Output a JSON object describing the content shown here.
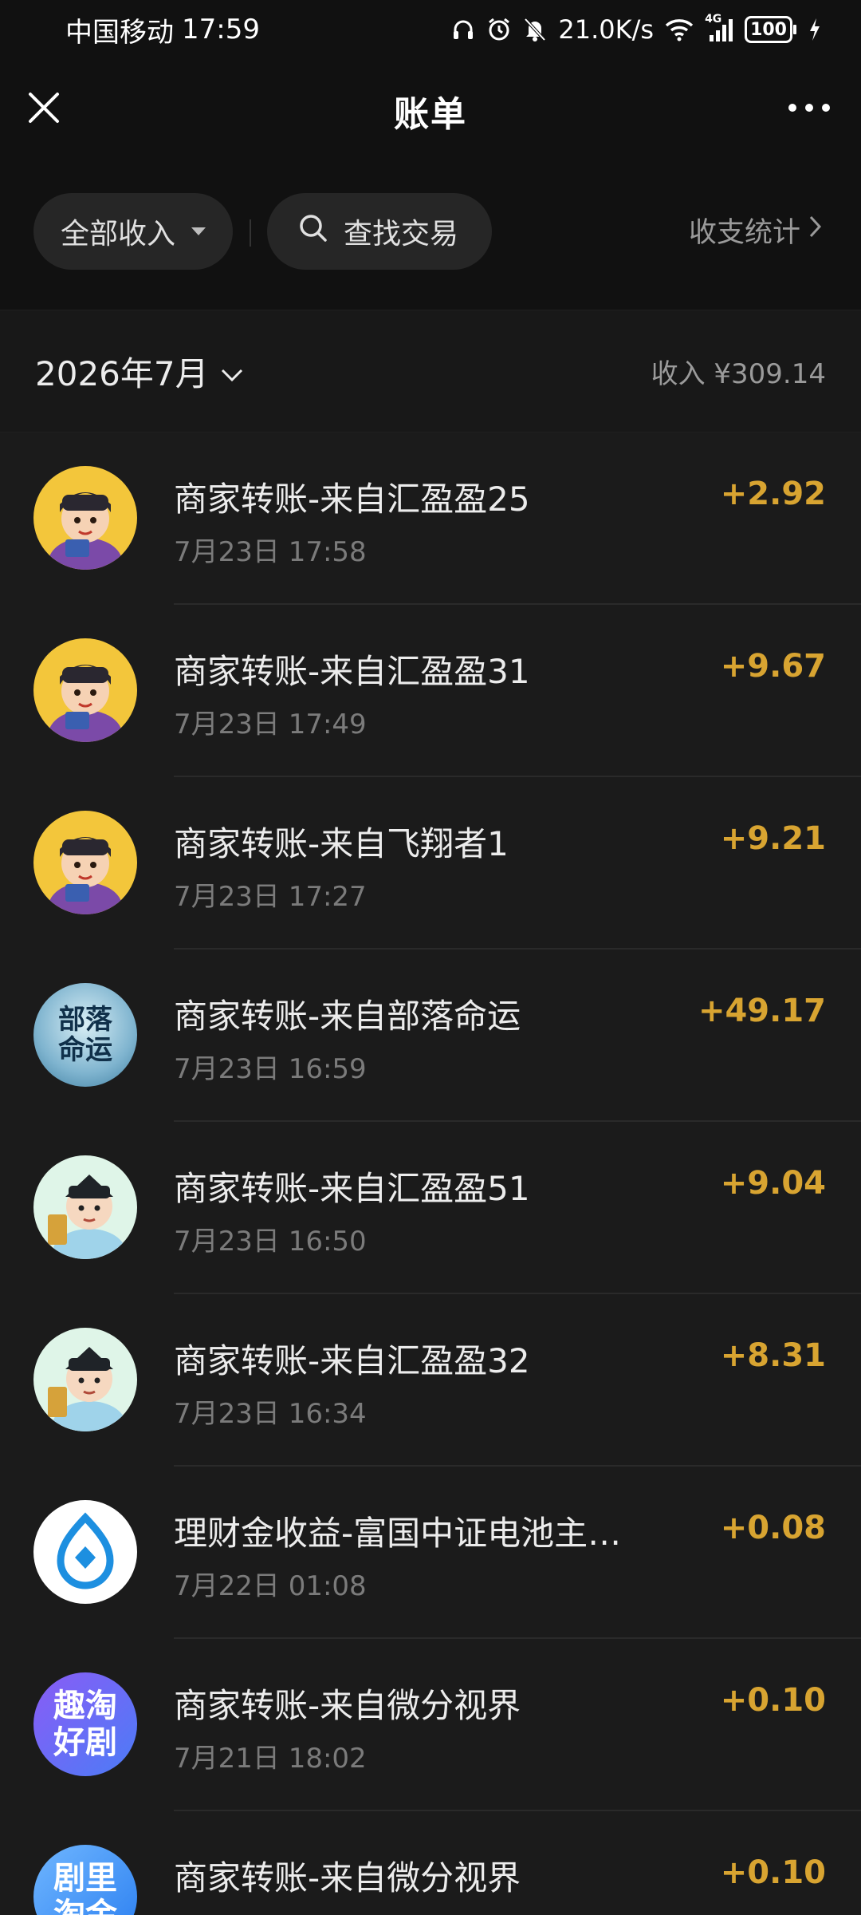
{
  "status_bar": {
    "carrier": "中国移动",
    "time": "17:59",
    "speed": "21.0K/s",
    "network": "4G",
    "battery": "100"
  },
  "nav": {
    "title": "账单"
  },
  "filters": {
    "income_label": "全部收入",
    "search_label": "查找交易",
    "stats_label": "收支统计"
  },
  "month": {
    "label": "2026年7月",
    "summary": "收入 ¥309.14"
  },
  "colors": {
    "amount": "#d8a431",
    "background": "#111111",
    "row": "#1b1b1b"
  },
  "transactions": [
    {
      "title": "商家转账-来自汇盈盈25",
      "time": "7月23日 17:58",
      "amount": "+2.92",
      "avatar": "scholar-yellow"
    },
    {
      "title": "商家转账-来自汇盈盈31",
      "time": "7月23日 17:49",
      "amount": "+9.67",
      "avatar": "scholar-yellow"
    },
    {
      "title": "商家转账-来自飞翔者1",
      "time": "7月23日 17:27",
      "amount": "+9.21",
      "avatar": "scholar-yellow"
    },
    {
      "title": "商家转账-来自部落命运",
      "time": "7月23日 16:59",
      "amount": "+49.17",
      "avatar": "calligraphy",
      "avatar_text": "部落命运"
    },
    {
      "title": "商家转账-来自汇盈盈51",
      "time": "7月23日 16:50",
      "amount": "+9.04",
      "avatar": "scholar-mint"
    },
    {
      "title": "商家转账-来自汇盈盈32",
      "time": "7月23日 16:34",
      "amount": "+8.31",
      "avatar": "scholar-mint"
    },
    {
      "title": "理财金收益-富国中证电池主…",
      "time": "7月22日 01:08",
      "amount": "+0.08",
      "avatar": "fund-logo"
    },
    {
      "title": "商家转账-来自微分视界",
      "time": "7月21日 18:02",
      "amount": "+0.10",
      "avatar": "text-logo",
      "avatar_text": "趣淘好剧"
    },
    {
      "title": "商家转账-来自微分视界",
      "time": "",
      "amount": "+0.10",
      "avatar": "text-logo-blue",
      "avatar_text": "剧里淘金"
    }
  ]
}
